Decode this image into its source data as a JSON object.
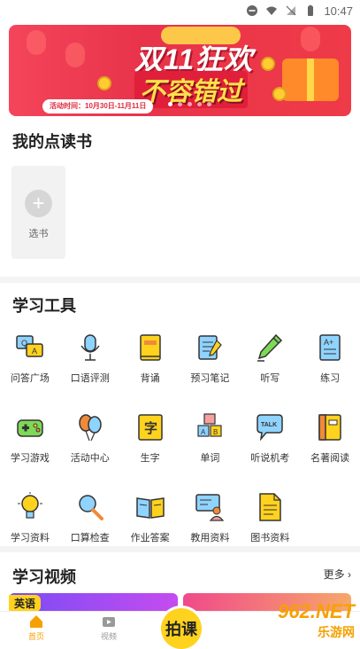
{
  "status": {
    "time": "10:47"
  },
  "banner": {
    "title_line1": "双11狂欢",
    "title_line2": "不容错过",
    "date_text": "活动时间：10月30日-11月11日",
    "slides_count": 5,
    "active_slide": 0
  },
  "my_books": {
    "title": "我的点读书",
    "add_label": "选书"
  },
  "tools": {
    "title": "学习工具",
    "items": [
      {
        "label": "问答广场",
        "icon": "qa-bubbles-icon"
      },
      {
        "label": "口语评测",
        "icon": "microphone-icon"
      },
      {
        "label": "背诵",
        "icon": "book-icon"
      },
      {
        "label": "预习笔记",
        "icon": "notebook-pen-icon"
      },
      {
        "label": "听写",
        "icon": "pencil-icon"
      },
      {
        "label": "练习",
        "icon": "exercise-sheet-icon"
      },
      {
        "label": "学习游戏",
        "icon": "gamepad-icon"
      },
      {
        "label": "活动中心",
        "icon": "balloons-icon"
      },
      {
        "label": "生字",
        "icon": "character-card-icon"
      },
      {
        "label": "单词",
        "icon": "letter-blocks-icon"
      },
      {
        "label": "听说机考",
        "icon": "talk-bubble-icon"
      },
      {
        "label": "名著阅读",
        "icon": "classic-book-icon"
      },
      {
        "label": "学习资料",
        "icon": "lightbulb-icon"
      },
      {
        "label": "口算检查",
        "icon": "magnifier-icon"
      },
      {
        "label": "作业答案",
        "icon": "open-book-icon"
      },
      {
        "label": "教用资料",
        "icon": "teacher-board-icon"
      },
      {
        "label": "图书资料",
        "icon": "document-icon"
      }
    ]
  },
  "videos": {
    "title": "学习视频",
    "more_label": "更多",
    "tag_label": "英语"
  },
  "tabbar": {
    "home": "首页",
    "video": "视频",
    "capture": "拍课"
  },
  "watermark": {
    "line1": "962.NET",
    "line2": "乐游网"
  },
  "colors": {
    "accent": "#f5a100",
    "banner_red": "#e8334a",
    "capture_yellow": "#ffd21e"
  }
}
